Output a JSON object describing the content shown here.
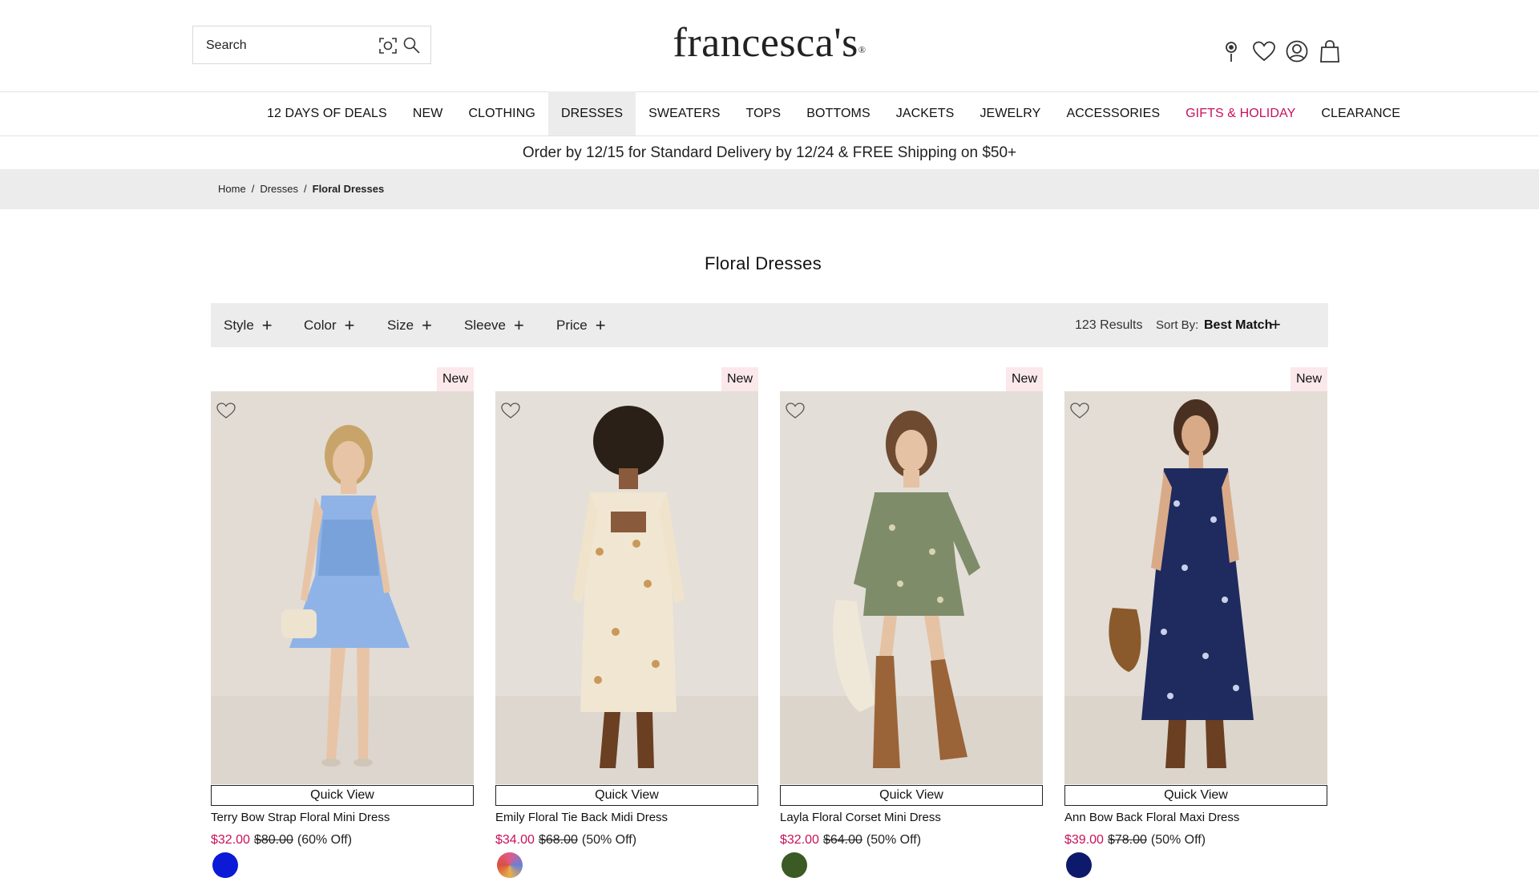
{
  "header": {
    "search_placeholder": "Search",
    "logo": "francesca's",
    "logo_mark": "®"
  },
  "nav": {
    "items": [
      {
        "label": "12 DAYS OF DEALS"
      },
      {
        "label": "NEW"
      },
      {
        "label": "CLOTHING"
      },
      {
        "label": "DRESSES"
      },
      {
        "label": "SWEATERS"
      },
      {
        "label": "TOPS"
      },
      {
        "label": "BOTTOMS"
      },
      {
        "label": "JACKETS"
      },
      {
        "label": "JEWELRY"
      },
      {
        "label": "ACCESSORIES"
      },
      {
        "label": "GIFTS & HOLIDAY"
      },
      {
        "label": "CLEARANCE"
      }
    ],
    "active": "DRESSES",
    "highlight_color": "#c8115a"
  },
  "promo": "Order by 12/15 for Standard Delivery by 12/24 & FREE Shipping on $50+",
  "breadcrumb": {
    "home": "Home",
    "sep": "/",
    "dresses": "Dresses",
    "current": "Floral Dresses"
  },
  "page_title": "Floral Dresses",
  "filters": {
    "style": "Style",
    "color": "Color",
    "size": "Size",
    "sleeve": "Sleeve",
    "price": "Price",
    "plus": "+",
    "results": "123 Results",
    "sort_label": "Sort By:",
    "sort_value": "Best Match"
  },
  "products": [
    {
      "badge": "New",
      "quick_view": "Quick View",
      "name": "Terry Bow Strap Floral Mini Dress",
      "sale": "$32.00",
      "orig": "$80.00",
      "off": "(60% Off)",
      "swatch_color": "#0a1ad6"
    },
    {
      "badge": "New",
      "quick_view": "Quick View",
      "name": "Emily Floral Tie Back Midi Dress",
      "sale": "$34.00",
      "orig": "$68.00",
      "off": "(50% Off)",
      "swatch_color": "multi"
    },
    {
      "badge": "New",
      "quick_view": "Quick View",
      "name": "Layla Floral Corset Mini Dress",
      "sale": "$32.00",
      "orig": "$64.00",
      "off": "(50% Off)",
      "swatch_color": "#3c5a23"
    },
    {
      "badge": "New",
      "quick_view": "Quick View",
      "name": "Ann Bow Back Floral Maxi Dress",
      "sale": "$39.00",
      "orig": "$78.00",
      "off": "(50% Off)",
      "swatch_color": "#0d1a6b"
    }
  ]
}
